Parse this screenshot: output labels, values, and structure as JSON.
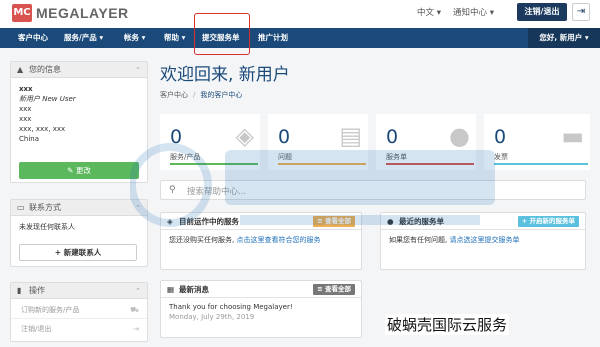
{
  "brand": {
    "logo_mark": "MC",
    "name": "MEGALAYER"
  },
  "top_links": {
    "language": "中文",
    "notifications": "通知中心",
    "logout": "注销/退出",
    "exit_icon": "logout-icon"
  },
  "nav": {
    "items": [
      {
        "label": "客户中心",
        "caret": ""
      },
      {
        "label": "服务/产品",
        "caret": "▾"
      },
      {
        "label": "帐务",
        "caret": "▾"
      },
      {
        "label": "帮助",
        "caret": "▾"
      },
      {
        "label": "提交服务单",
        "caret": ""
      },
      {
        "label": "推广计划",
        "caret": ""
      }
    ],
    "hello": "您好, 新用户 ▾"
  },
  "sidebar": {
    "info": {
      "title": "您的信息",
      "name": "xxx",
      "company": "新用户 New User",
      "address1": "xxx",
      "address2": "xxx",
      "city": "xxx, xxx, xxx",
      "country": "China",
      "update_button": "✎ 更改"
    },
    "contacts": {
      "title": "联系方式",
      "empty_text": "未发现任何联系人",
      "add_button": "+ 新建联系人"
    },
    "actions": {
      "title": "操作",
      "items": [
        "订购新的服务/产品",
        "注销/退出"
      ]
    }
  },
  "main": {
    "welcome": "欢迎回来, 新用户",
    "breadcrumb": [
      "客户中心",
      "我的客户中心"
    ],
    "stats": [
      {
        "value": "0",
        "label": "服务/产品",
        "color": "#5cb85c",
        "icon": "cube-icon"
      },
      {
        "value": "0",
        "label": "问题",
        "color": "#f0ad4e",
        "icon": "document-icon"
      },
      {
        "value": "0",
        "label": "服务单",
        "color": "#d9534f",
        "icon": "comments-icon"
      },
      {
        "value": "0",
        "label": "发票",
        "color": "#5bc0de",
        "icon": "credit-card-icon"
      }
    ],
    "search_placeholder": "搜索帮助中心...",
    "services_card": {
      "title": "目前运作中的服务",
      "button": "≡ 查看全部",
      "text": "您还没购买任何服务, ",
      "link": "点击这里查看符合您的服务"
    },
    "tickets_card": {
      "title": "最近的服务单",
      "button": "+ 开启新的服务单",
      "text": "如果您有任何问题, ",
      "link": "请点选这里提交服务单"
    },
    "news_card": {
      "title": "最新消息",
      "button": "≡ 查看全部",
      "headline": "Thank you for choosing Megalayer!",
      "date": "Monday, July 29th, 2019"
    }
  },
  "watermark_text": "破蜗壳国际云服务",
  "colors": {
    "nav_bg": "#1b4a7a",
    "dark_btn": "#1b3a5e",
    "green": "#5cb85c",
    "orange": "#f0ad4e",
    "teal": "#5bc0de",
    "gray_btn": "#777777"
  }
}
